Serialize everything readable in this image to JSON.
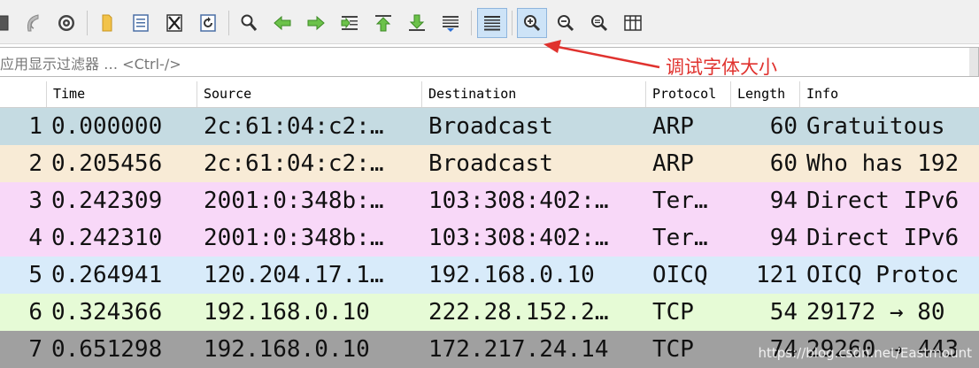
{
  "toolbar": {
    "buttons": [
      {
        "name": "stop-capture-button",
        "icon": "stop-square-icon"
      },
      {
        "name": "restart-capture-button",
        "icon": "fin-restart-icon"
      },
      {
        "name": "capture-options-button",
        "icon": "gear-icon"
      },
      {
        "name": "open-file-button",
        "icon": "folder-icon"
      },
      {
        "name": "save-file-button",
        "icon": "document-icon"
      },
      {
        "name": "close-file-button",
        "icon": "close-file-icon"
      },
      {
        "name": "reload-file-button",
        "icon": "reload-icon"
      },
      {
        "name": "find-packet-button",
        "icon": "magnifier-icon"
      },
      {
        "name": "go-back-button",
        "icon": "arrow-left-icon"
      },
      {
        "name": "go-forward-button",
        "icon": "arrow-right-icon"
      },
      {
        "name": "go-to-packet-button",
        "icon": "jump-to-icon"
      },
      {
        "name": "first-packet-button",
        "icon": "arrow-up-icon"
      },
      {
        "name": "last-packet-button",
        "icon": "arrow-down-icon"
      },
      {
        "name": "auto-scroll-button",
        "icon": "autoscroll-icon"
      },
      {
        "name": "colorize-button",
        "icon": "lines-icon"
      },
      {
        "name": "zoom-in-button",
        "icon": "zoom-in-icon"
      },
      {
        "name": "zoom-out-button",
        "icon": "zoom-out-icon"
      },
      {
        "name": "normal-size-button",
        "icon": "zoom-reset-icon"
      },
      {
        "name": "resize-columns-button",
        "icon": "resize-columns-icon"
      }
    ]
  },
  "filter": {
    "placeholder": "应用显示过滤器 … <Ctrl-/>"
  },
  "annotation": {
    "text": "调试字体大小",
    "color": "#e0322e"
  },
  "columns": {
    "no": "",
    "time": "Time",
    "source": "Source",
    "destination": "Destination",
    "protocol": "Protocol",
    "length": "Length",
    "info": "Info"
  },
  "packets": [
    {
      "no": "1",
      "time": "0.000000",
      "source": "2c:61:04:c2:…",
      "destination": "Broadcast",
      "protocol": "ARP",
      "length": "60",
      "info": "Gratuitous",
      "bg": "#c5dbe2"
    },
    {
      "no": "2",
      "time": "0.205456",
      "source": "2c:61:04:c2:…",
      "destination": "Broadcast",
      "protocol": "ARP",
      "length": "60",
      "info": "Who has 192",
      "bg": "#f8ebd6"
    },
    {
      "no": "3",
      "time": "0.242309",
      "source": "2001:0:348b:…",
      "destination": "103:308:402:…",
      "protocol": "Ter…",
      "length": "94",
      "info": "Direct IPv6",
      "bg": "#f8d8f8"
    },
    {
      "no": "4",
      "time": "0.242310",
      "source": "2001:0:348b:…",
      "destination": "103:308:402:…",
      "protocol": "Ter…",
      "length": "94",
      "info": "Direct IPv6",
      "bg": "#f8d8f8"
    },
    {
      "no": "5",
      "time": "0.264941",
      "source": "120.204.17.1…",
      "destination": "192.168.0.10",
      "protocol": "OICQ",
      "length": "121",
      "info": "OICQ Protoc",
      "bg": "#d8ebfa"
    },
    {
      "no": "6",
      "time": "0.324366",
      "source": "192.168.0.10",
      "destination": "222.28.152.2…",
      "protocol": "TCP",
      "length": "54",
      "info": "29172 → 80",
      "bg": "#e6fbd6"
    },
    {
      "no": "7",
      "time": "0.651298",
      "source": "192.168.0.10",
      "destination": "172.217.24.14",
      "protocol": "TCP",
      "length": "74",
      "info": "29260 → 443",
      "bg": "#a0a0a0"
    }
  ],
  "watermark": "https://blog.csdn.net/Eastmount"
}
